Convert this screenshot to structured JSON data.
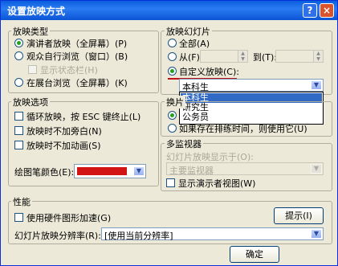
{
  "title": "设置放映方式",
  "help_glyph": "?",
  "close_glyph": "×",
  "show_type": {
    "label": "放映类型",
    "options": [
      "演讲者放映（全屏幕）(P)",
      "观众自行浏览（窗口）(B)",
      "在展台浏览（全屏幕）(K)"
    ],
    "show_scrollbar": "显示状态栏(H)",
    "selected_index": 0
  },
  "slides": {
    "label": "放映幻灯片",
    "all": "全部(A)",
    "from": "从(F):",
    "to": "到(T):",
    "custom": "自定义放映(C):",
    "custom_value": "本科生",
    "selected": "custom"
  },
  "custom_list": {
    "items": [
      "本科生",
      "研究生",
      "公务员"
    ],
    "selected_index": 0
  },
  "show_options": {
    "label": "放映选项",
    "loop": "循环放映，按 ESC 键终止(L)",
    "no_narration": "放映时不加旁白(N)",
    "no_animation": "放映时不加动画(S)",
    "pen_color_label": "绘图笔颜色(E):",
    "pen_color": "#d21414"
  },
  "advance": {
    "label_fragment": "换片",
    "use_timings": "如果存在排练时间，则使用它(U)"
  },
  "monitors": {
    "label": "多监视器",
    "show_on": "幻灯片放映显示于(O):",
    "monitor_value": "主要监视器",
    "presenter_view": "显示演示者视图(W)"
  },
  "performance": {
    "label": "性能",
    "hw_accel": "使用硬件图形加速(G)",
    "tips_button": "提示(I)",
    "resolution_label": "幻灯片放映分辨率(R):",
    "resolution_value": "[使用当前分辨率]"
  },
  "ok_button": "确定"
}
